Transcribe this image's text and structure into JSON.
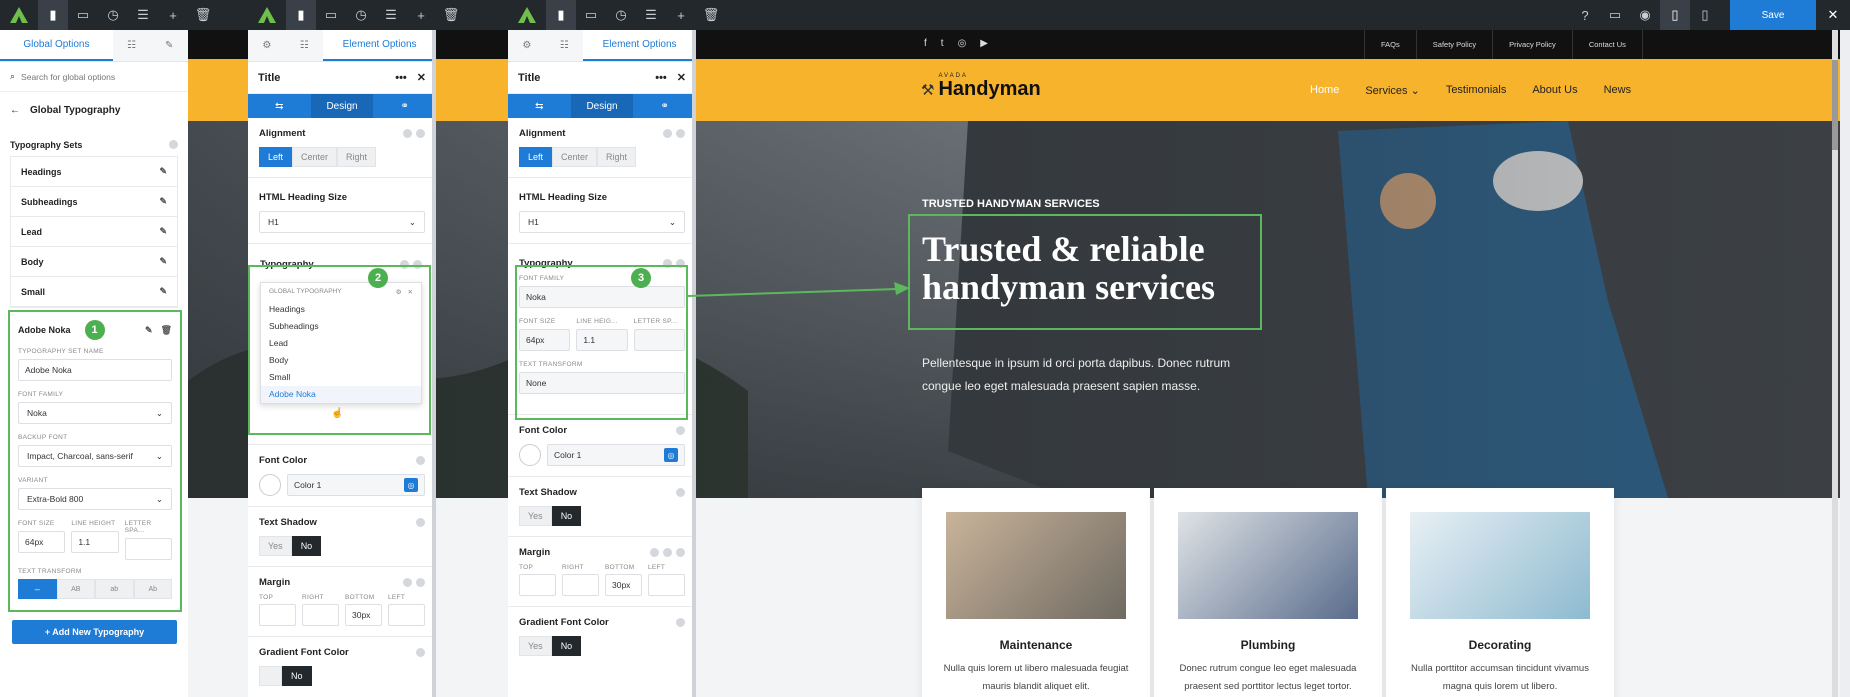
{
  "toolbar": {
    "save": "Save",
    "close": "✕"
  },
  "global_panel": {
    "tab_title": "Global Options",
    "search_placeholder": "Search for global options",
    "back_title": "Global Typography",
    "sets_label": "Typography Sets",
    "sets": [
      "Headings",
      "Subheadings",
      "Lead",
      "Body",
      "Small"
    ],
    "active_set": "Adobe Noka",
    "badge": "1",
    "set_name_label": "TYPOGRAPHY SET NAME",
    "set_name": "Adobe Noka",
    "font_family_label": "FONT FAMILY",
    "font_family": "Noka",
    "backup_label": "BACKUP FONT",
    "backup": "Impact, Charcoal, sans-serif",
    "variant_label": "VARIANT",
    "variant": "Extra-Bold 800",
    "font_size_label": "FONT SIZE",
    "font_size": "64px",
    "line_height_label": "LINE HEIGHT",
    "line_height": "1.1",
    "letter_spacing_label": "LETTER SPA...",
    "transform_label": "TEXT TRANSFORM",
    "transform_opts": [
      "–",
      "AB",
      "ab",
      "Ab"
    ],
    "add_button": "+ Add New Typography"
  },
  "el_panel1": {
    "tab_title": "Element Options",
    "title": "Title",
    "design": "Design",
    "alignment": "Alignment",
    "align_opts": [
      "Left",
      "Center",
      "Right"
    ],
    "heading_size_label": "HTML Heading Size",
    "heading_size": "H1",
    "typography": "Typography",
    "badge": "2",
    "dd_header": "GLOBAL TYPOGRAPHY",
    "dd_items": [
      "Headings",
      "Subheadings",
      "Lead",
      "Body",
      "Small",
      "Adobe Noka"
    ],
    "font_color": "Font Color",
    "color_val": "Color 1",
    "shadow": "Text Shadow",
    "yes": "Yes",
    "no": "No",
    "margin": "Margin",
    "m_labels": [
      "TOP",
      "RIGHT",
      "BOTTOM",
      "LEFT"
    ],
    "m_bottom": "30px",
    "gradient": "Gradient Font Color",
    "no2": "No"
  },
  "el_panel2": {
    "tab_title": "Element Options",
    "title": "Title",
    "design": "Design",
    "alignment": "Alignment",
    "align_opts": [
      "Left",
      "Center",
      "Right"
    ],
    "heading_size_label": "HTML Heading Size",
    "heading_size": "H1",
    "typography": "Typography",
    "badge": "3",
    "ff_label": "FONT FAMILY",
    "ff": "Noka",
    "fs_label": "FONT SIZE",
    "fs": "64px",
    "lh_label": "LINE HEIG...",
    "lh": "1.1",
    "ls_label": "LETTER SP...",
    "tt_label": "TEXT TRANSFORM",
    "tt": "None",
    "font_color": "Font Color",
    "color_val": "Color 1",
    "shadow": "Text Shadow",
    "yes": "Yes",
    "no": "No",
    "margin": "Margin",
    "m_labels": [
      "TOP",
      "RIGHT",
      "BOTTOM",
      "LEFT"
    ],
    "m_bottom": "30px",
    "gradient": "Gradient Font Color",
    "yes2": "Yes",
    "no2": "No"
  },
  "site": {
    "top_links": [
      "FAQs",
      "Safety Policy",
      "Privacy Policy",
      "Contact Us"
    ],
    "logo_small": "AVADA",
    "logo": "Handyman",
    "nav": [
      "Home",
      "Services",
      "Testimonials",
      "About Us",
      "News"
    ],
    "eyebrow": "TRUSTED HANDYMAN SERVICES",
    "headline1": "Trusted & reliable",
    "headline2": "handyman services",
    "lead1": "Pellentesque in ipsum id orci porta dapibus. Donec rutrum",
    "lead2": "congue leo eget malesuada praesent sapien masse.",
    "cards": [
      {
        "title": "Maintenance",
        "desc": "Nulla quis lorem ut libero malesuada feugiat mauris blandit aliquet elit."
      },
      {
        "title": "Plumbing",
        "desc": "Donec rutrum congue leo eget malesuada praesent sed porttitor lectus leget tortor."
      },
      {
        "title": "Decorating",
        "desc": "Nulla porttitor accumsan tincidunt vivamus magna quis lorem ut libero."
      }
    ]
  },
  "colors": {
    "accent": "#1e7bd6",
    "brand_yellow": "#f7b32b",
    "toolbar": "#23282d",
    "highlight_green": "#5cb85c"
  }
}
